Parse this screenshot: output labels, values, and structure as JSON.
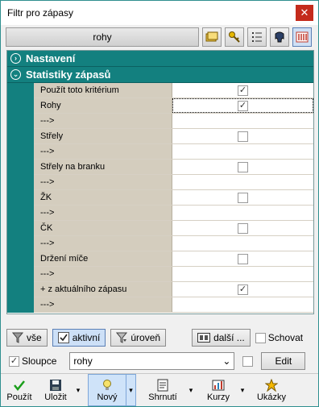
{
  "window": {
    "title": "Filtr pro zápasy",
    "close": "✕"
  },
  "toolbar": {
    "main_label": "rohy",
    "icons": [
      "folder-icon",
      "key-icon",
      "list-icon",
      "shape-icon",
      "bars-icon"
    ]
  },
  "sections": {
    "nastaveni": "Nastavení",
    "statistiky": "Statistiky zápasů"
  },
  "rows": [
    {
      "label": "Použít toto kritérium",
      "checked": true
    },
    {
      "label": "Rohy",
      "checked": true,
      "selected": true
    },
    {
      "label": "--->",
      "checked": null
    },
    {
      "label": "Střely",
      "checked": false
    },
    {
      "label": "--->",
      "checked": null
    },
    {
      "label": "Střely na branku",
      "checked": false
    },
    {
      "label": "--->",
      "checked": null
    },
    {
      "label": "ŽK",
      "checked": false
    },
    {
      "label": "--->",
      "checked": null
    },
    {
      "label": "ČK",
      "checked": false
    },
    {
      "label": "--->",
      "checked": null
    },
    {
      "label": "Držení míče",
      "checked": false
    },
    {
      "label": "--->",
      "checked": null
    },
    {
      "label": "+ z aktuálního zápasu",
      "checked": true
    },
    {
      "label": "--->",
      "checked": null
    }
  ],
  "filter_bar": {
    "all": "vše",
    "active": "aktivní",
    "level": "úroveň",
    "more": "další ...",
    "hide": "Schovat"
  },
  "columns_bar": {
    "columns_label": "Sloupce",
    "columns_checked": true,
    "select_value": "rohy",
    "edit": "Edit"
  },
  "bottom_bar": {
    "use": "Použít",
    "save": "Uložit",
    "new": "Nový",
    "summary": "Shrnutí",
    "courses": "Kurzy",
    "examples": "Ukázky"
  }
}
